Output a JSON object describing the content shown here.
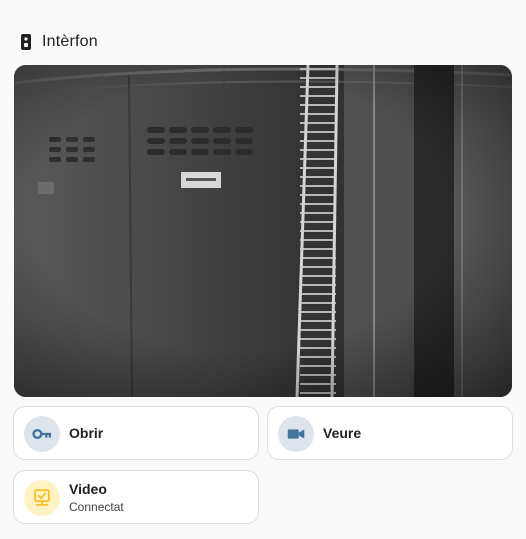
{
  "header": {
    "title": "Intèrfon",
    "icon": "doorbell-icon"
  },
  "camera": {
    "name": "intercom-camera-feed"
  },
  "tiles": {
    "open": {
      "name": "Obrir",
      "icon": "key-icon",
      "icon_color": "#44739e",
      "icon_bg": "#dde4ec"
    },
    "view": {
      "name": "Veure",
      "icon": "video-camera-icon",
      "icon_color": "#44739e",
      "icon_bg": "#dde4ec"
    },
    "video": {
      "name": "Video",
      "state": "Connectat",
      "icon": "monitor-check-icon",
      "icon_color": "#fbc02d",
      "icon_bg": "#fff3c4"
    }
  },
  "colors": {
    "background": "#fafafa",
    "card_border": "#e0e0e0",
    "primary_icon": "#44739e",
    "active_icon": "#fbc02d"
  }
}
